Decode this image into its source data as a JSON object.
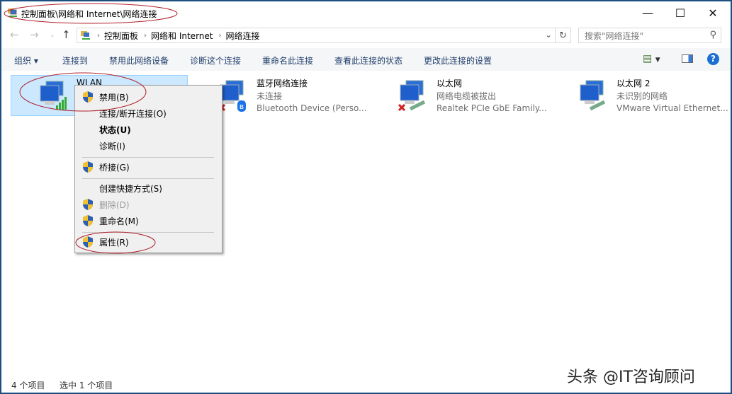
{
  "window": {
    "title": "控制面板\\网络和 Internet\\网络连接"
  },
  "address": {
    "crumbs": [
      "控制面板",
      "网络和 Internet",
      "网络连接"
    ],
    "search_placeholder": "搜索\"网络连接\""
  },
  "toolbar": {
    "organize": "组织 ▾",
    "items": [
      "连接到",
      "禁用此网络设备",
      "诊断这个连接",
      "重命名此连接",
      "查看此连接的状态",
      "更改此连接的设置"
    ]
  },
  "connections": [
    {
      "name": "WLAN",
      "status": "",
      "device": ""
    },
    {
      "name": "蓝牙网络连接",
      "status": "未连接",
      "device": "Bluetooth Device (Perso..."
    },
    {
      "name": "以太网",
      "status": "网络电缆被拔出",
      "device": "Realtek PCIe GbE Family..."
    },
    {
      "name": "以太网 2",
      "status": "未识别的网络",
      "device": "VMware Virtual Ethernet..."
    }
  ],
  "context_menu": [
    {
      "label": "禁用(B)"
    },
    {
      "label": "连接/断开连接(O)"
    },
    {
      "label": "状态(U)"
    },
    {
      "label": "诊断(I)"
    },
    {
      "label": "桥接(G)"
    },
    {
      "label": "创建快捷方式(S)"
    },
    {
      "label": "删除(D)"
    },
    {
      "label": "重命名(M)"
    },
    {
      "label": "属性(R)"
    }
  ],
  "status": {
    "count": "4 个项目",
    "selected": "选中 1 个项目"
  },
  "watermark": "头条 @IT咨询顾问",
  "colors": {
    "selection": "#cce8ff",
    "annotation": "#b0202a",
    "link": "#1e3d6b"
  }
}
